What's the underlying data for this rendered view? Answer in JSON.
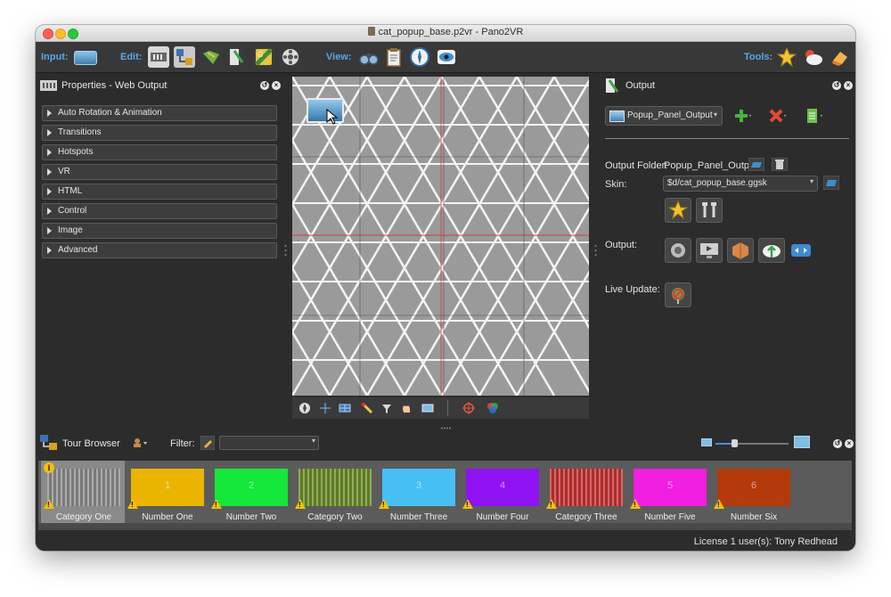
{
  "window": {
    "title": "cat_popup_base.p2vr - Pano2VR"
  },
  "toolbar": {
    "input_label": "Input:",
    "edit_label": "Edit:",
    "view_label": "View:",
    "tools_label": "Tools:"
  },
  "properties": {
    "title": "Properties - Web Output",
    "sections": [
      "Auto Rotation & Animation",
      "Transitions",
      "Hotspots",
      "VR",
      "HTML",
      "Control",
      "Image",
      "Advanced"
    ]
  },
  "output": {
    "title": "Output",
    "profile": "Popup_Panel_Output",
    "folder_label": "Output Folder:",
    "folder_value": "Popup_Panel_Output",
    "skin_label": "Skin:",
    "skin_value": "$d/cat_popup_base.ggsk",
    "output_label": "Output:",
    "live_update_label": "Live Update:"
  },
  "tour_browser": {
    "title": "Tour Browser",
    "filter_label": "Filter:",
    "filter_value": "",
    "items": [
      {
        "label": "Category One",
        "number": "",
        "color": "#8f8f8f",
        "pattern": true
      },
      {
        "label": "Number One",
        "number": "1",
        "color": "#eab400",
        "pattern": false
      },
      {
        "label": "Number Two",
        "number": "2",
        "color": "#14e83a",
        "pattern": false
      },
      {
        "label": "Category Two",
        "number": "",
        "color": "#6d8f2a",
        "pattern": true
      },
      {
        "label": "Number Three",
        "number": "3",
        "color": "#47bff2",
        "pattern": false
      },
      {
        "label": "Number Four",
        "number": "4",
        "color": "#8f12f2",
        "pattern": false
      },
      {
        "label": "Category Three",
        "number": "",
        "color": "#c93434",
        "pattern": true
      },
      {
        "label": "Number Five",
        "number": "5",
        "color": "#f21ee0",
        "pattern": false
      },
      {
        "label": "Number Six",
        "number": "6",
        "color": "#b33a0a",
        "pattern": false
      }
    ]
  },
  "status": {
    "license": "License 1 user(s): Tony Redhead"
  }
}
